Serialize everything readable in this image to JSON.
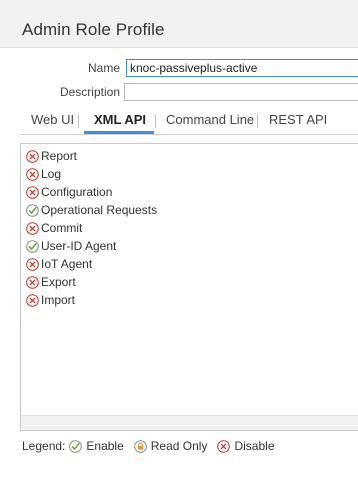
{
  "dialog": {
    "title": "Admin Role Profile"
  },
  "form": {
    "name_label": "Name",
    "name_value": "knoc-passiveplus-active",
    "description_label": "Description",
    "description_value": ""
  },
  "tabs": [
    {
      "label": "Web UI"
    },
    {
      "label": "XML API"
    },
    {
      "label": "Command Line"
    },
    {
      "label": "REST API"
    }
  ],
  "permissions": [
    {
      "label": "Report",
      "state": "disable"
    },
    {
      "label": "Log",
      "state": "disable"
    },
    {
      "label": "Configuration",
      "state": "disable"
    },
    {
      "label": "Operational Requests",
      "state": "enable"
    },
    {
      "label": "Commit",
      "state": "disable"
    },
    {
      "label": "User-ID Agent",
      "state": "enable"
    },
    {
      "label": "IoT Agent",
      "state": "disable"
    },
    {
      "label": "Export",
      "state": "disable"
    },
    {
      "label": "Import",
      "state": "disable"
    }
  ],
  "legend": {
    "prefix": "Legend:",
    "enable": "Enable",
    "read_only": "Read Only",
    "disable": "Disable"
  },
  "colors": {
    "accent": "#3e8ed8",
    "enable": "#6aa83a",
    "read_only": "#d79a2b",
    "disable": "#c0392b"
  }
}
